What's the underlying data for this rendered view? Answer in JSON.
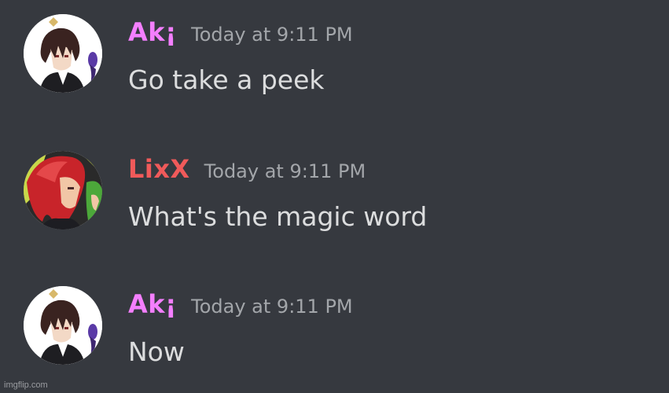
{
  "theme": {
    "background": "#36393f",
    "message_text_color": "#dcddde",
    "timestamp_color": "#a3a6aa"
  },
  "messages": [
    {
      "author": "Ak¡",
      "author_color": "#f47fff",
      "timestamp": "Today at 9:11 PM",
      "text": "Go take a peek",
      "avatar": "anime-boy-avatar"
    },
    {
      "author": "LixX",
      "author_color": "#f05a5a",
      "timestamp": "Today at 9:11 PM",
      "text": "What's the magic word",
      "avatar": "red-hair-anime-avatar"
    },
    {
      "author": "Ak¡",
      "author_color": "#f47fff",
      "timestamp": "Today at 9:11 PM",
      "text": "Now",
      "avatar": "anime-boy-avatar"
    }
  ],
  "watermark": "imgflip.com"
}
